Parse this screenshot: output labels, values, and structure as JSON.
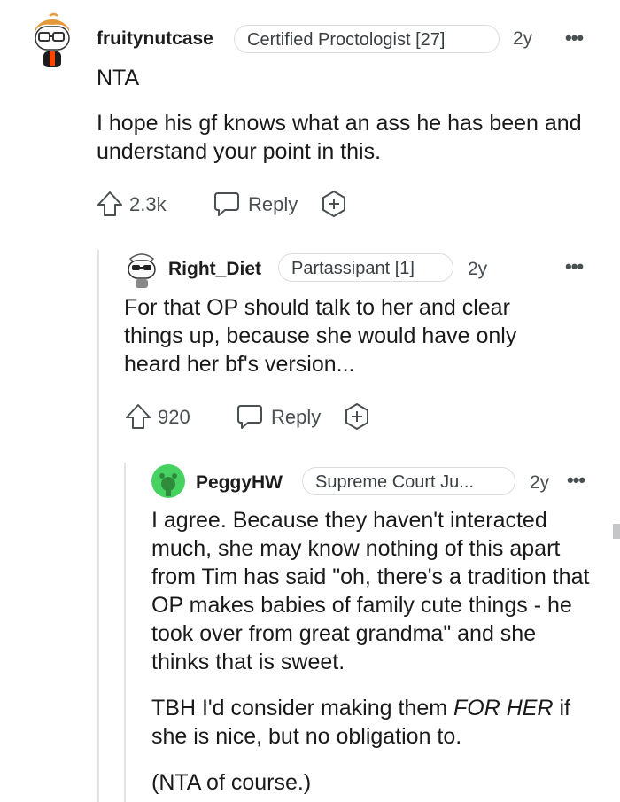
{
  "comments": [
    {
      "username": "fruitynutcase",
      "flair": "Certified Proctologist [27]",
      "age": "2y",
      "paragraphs": [
        "NTA",
        "I hope his gf knows what an ass he has been and understand your point in this."
      ],
      "votes": "2.3k",
      "reply_label": "Reply"
    },
    {
      "username": "Right_Diet",
      "flair": "Partassipant [1]",
      "age": "2y",
      "paragraphs": [
        "For that OP should talk to her and clear things up, because she would have only heard her bf's version..."
      ],
      "votes": "920",
      "reply_label": "Reply"
    },
    {
      "username": "PeggyHW",
      "flair": "Supreme Court Ju...",
      "age": "2y",
      "paragraphs": [
        "I agree. Because they haven't interacted much, she may know nothing of this apart from Tim has said \"oh, there's a tradition that OP makes babies of family cute things - he took over from great grandma\" and she thinks that is sweet.",
        "TBH I'd consider making them ",
        "FOR HER",
        " if she is nice, but no obligation to.",
        "(NTA of course.)"
      ]
    }
  ],
  "more_options": "•••"
}
